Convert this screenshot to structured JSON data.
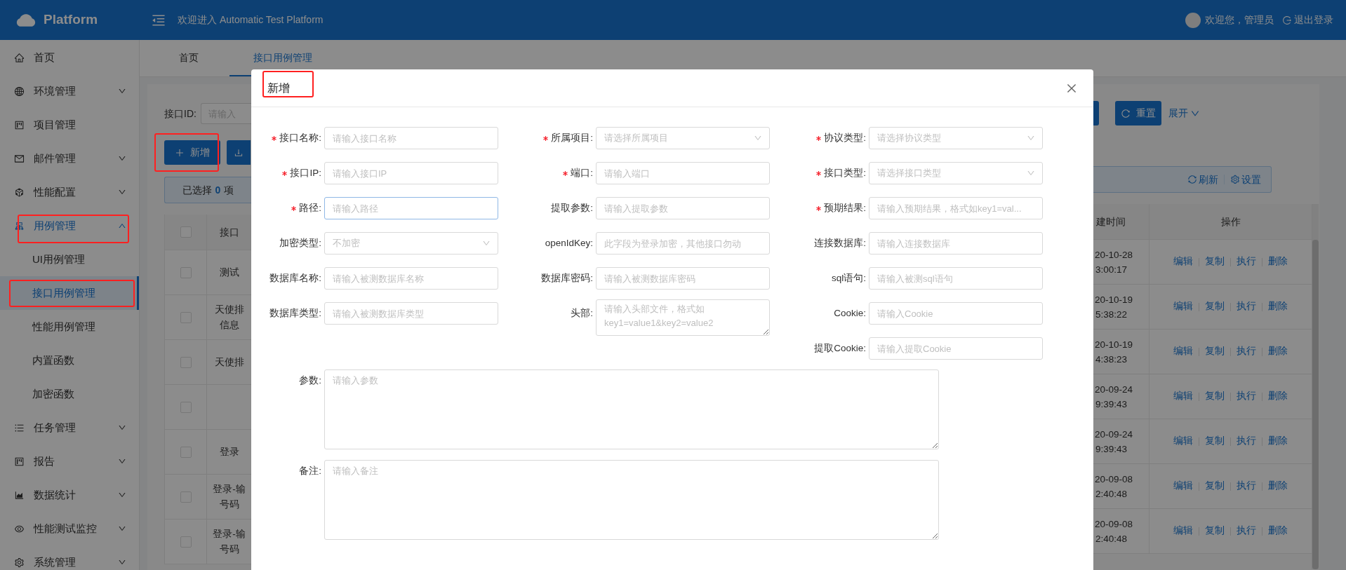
{
  "header": {
    "logo": "Platform",
    "welcome": "欢迎进入 Automatic Test Platform",
    "user": "欢迎您，管理员",
    "logout": "退出登录"
  },
  "sidebar": {
    "items": [
      {
        "label": "首页",
        "kind": "link",
        "highlighted": false
      },
      {
        "label": "环境管理",
        "kind": "group",
        "expanded": false,
        "highlighted": false
      },
      {
        "label": "项目管理",
        "kind": "link",
        "highlighted": false
      },
      {
        "label": "邮件管理",
        "kind": "group",
        "expanded": false,
        "highlighted": false
      },
      {
        "label": "性能配置",
        "kind": "group",
        "expanded": false,
        "highlighted": false
      },
      {
        "label": "用例管理",
        "kind": "group",
        "expanded": true,
        "highlighted": true,
        "children": [
          {
            "label": "UI用例管理",
            "selected": false,
            "highlighted": false
          },
          {
            "label": "接口用例管理",
            "selected": true,
            "highlighted": true
          },
          {
            "label": "性能用例管理",
            "selected": false,
            "highlighted": false
          },
          {
            "label": "内置函数",
            "selected": false,
            "highlighted": false
          },
          {
            "label": "加密函数",
            "selected": false,
            "highlighted": false
          }
        ]
      },
      {
        "label": "任务管理",
        "kind": "group",
        "expanded": false,
        "highlighted": false
      },
      {
        "label": "报告",
        "kind": "group",
        "expanded": false,
        "highlighted": false
      },
      {
        "label": "数据统计",
        "kind": "group",
        "expanded": false,
        "highlighted": false
      },
      {
        "label": "性能测试监控",
        "kind": "group",
        "expanded": false,
        "highlighted": false
      },
      {
        "label": "系统管理",
        "kind": "group",
        "expanded": false,
        "highlighted": false
      }
    ]
  },
  "tabs": [
    {
      "label": "首页",
      "selected": false
    },
    {
      "label": "接口用例管理",
      "selected": true
    }
  ],
  "filter": {
    "label": "接口ID:",
    "placeholder": "请输入"
  },
  "toolbar": {
    "add_button": {
      "label": "新增",
      "highlighted": true
    },
    "reset_button": "重置",
    "expand_link": "展开"
  },
  "selection": {
    "prefix": "已选择",
    "count": "0",
    "suffix": "项",
    "refresh": "刷新",
    "settings": "设置"
  },
  "table": {
    "columns": [
      "接口",
      "建时间",
      "操作"
    ],
    "select_all": {
      "checked": false
    },
    "rows": [
      {
        "checked": false,
        "name": [
          "测试"
        ],
        "created": [
          "20-10-28",
          "3:00:17"
        ],
        "actions": [
          "编辑",
          "复制",
          "执行",
          "删除"
        ]
      },
      {
        "checked": false,
        "name": [
          "天使排",
          "信息"
        ],
        "created": [
          "20-10-19",
          "5:38:22"
        ],
        "actions": [
          "编辑",
          "复制",
          "执行",
          "删除"
        ]
      },
      {
        "checked": false,
        "name": [
          "天使排"
        ],
        "created": [
          "20-10-19",
          "4:38:23"
        ],
        "actions": [
          "编辑",
          "复制",
          "执行",
          "删除"
        ]
      },
      {
        "checked": false,
        "created": [
          "20-09-24",
          "9:39:43"
        ],
        "actions": [
          "编辑",
          "复制",
          "执行",
          "删除"
        ]
      },
      {
        "checked": false,
        "name": [
          "登录"
        ],
        "created": [
          "20-09-24",
          "9:39:43"
        ],
        "actions": [
          "编辑",
          "复制",
          "执行",
          "删除"
        ]
      },
      {
        "checked": false,
        "name": [
          "登录-输",
          "号码"
        ],
        "created": [
          "20-09-08",
          "2:40:48"
        ],
        "actions": [
          "编辑",
          "复制",
          "执行",
          "删除"
        ]
      },
      {
        "checked": false,
        "name": [
          "登录-输",
          "号码"
        ],
        "created": [
          "20-09-08",
          "2:40:48"
        ],
        "actions": [
          "编辑",
          "复制",
          "执行",
          "删除"
        ]
      }
    ]
  },
  "dialog": {
    "title": "新增",
    "highlighted": true,
    "columns": [
      [
        {
          "label": "接口名称:",
          "required": true,
          "kind": "input",
          "placeholder": "请输入接口名称",
          "focused": false
        },
        {
          "label": "接口IP:",
          "required": true,
          "kind": "input",
          "placeholder": "请输入接口IP",
          "focused": false
        },
        {
          "label": "路径:",
          "required": true,
          "kind": "input",
          "placeholder": "请输入路径",
          "focused": true
        },
        {
          "label": "加密类型:",
          "required": false,
          "kind": "select",
          "value": "不加密",
          "disabled": true,
          "focused": false
        },
        {
          "label": "数据库名称:",
          "required": false,
          "kind": "input",
          "placeholder": "请输入被测数据库名称",
          "focused": false
        },
        {
          "label": "数据库类型:",
          "required": false,
          "kind": "input",
          "placeholder": "请输入被测数据库类型",
          "focused": false
        }
      ],
      [
        {
          "label": "所属项目:",
          "required": true,
          "kind": "select",
          "placeholder": "请选择所属项目",
          "focused": false
        },
        {
          "label": "端口:",
          "required": true,
          "kind": "input",
          "placeholder": "请输入端口",
          "focused": false
        },
        {
          "label": "提取参数:",
          "required": false,
          "kind": "input",
          "placeholder": "请输入提取参数",
          "focused": false
        },
        {
          "label": "openIdKey:",
          "required": false,
          "kind": "input",
          "placeholder": "此字段为登录加密，其他接口勿动",
          "focused": false
        },
        {
          "label": "数据库密码:",
          "required": false,
          "kind": "input",
          "placeholder": "请输入被测数据库密码",
          "focused": false
        },
        {
          "label": "头部:",
          "required": false,
          "kind": "textarea",
          "placeholder": "请输入头部文件，格式如key1=value1&key2=value2",
          "focused": false
        }
      ],
      [
        {
          "label": "协议类型:",
          "required": true,
          "kind": "select",
          "placeholder": "请选择协议类型",
          "focused": false
        },
        {
          "label": "接口类型:",
          "required": true,
          "kind": "select",
          "placeholder": "请选择接口类型",
          "focused": false
        },
        {
          "label": "预期结果:",
          "required": true,
          "kind": "input",
          "placeholder": "请输入预期结果，格式如key1=val...",
          "focused": false
        },
        {
          "label": "连接数据库:",
          "required": false,
          "kind": "input",
          "placeholder": "请输入连接数据库",
          "focused": false
        },
        {
          "label": "sql语句:",
          "required": false,
          "kind": "input",
          "placeholder": "请输入被测sql语句",
          "focused": false
        },
        {
          "label": "Cookie:",
          "required": false,
          "kind": "input",
          "placeholder": "请输入Cookie",
          "focused": false
        },
        {
          "label": "提取Cookie:",
          "required": false,
          "kind": "input",
          "placeholder": "请输入提取Cookie",
          "focused": false
        }
      ]
    ],
    "textareas": [
      {
        "label": "参数:",
        "placeholder": "请输入参数"
      },
      {
        "label": "备注:",
        "placeholder": "请输入备注"
      }
    ]
  }
}
